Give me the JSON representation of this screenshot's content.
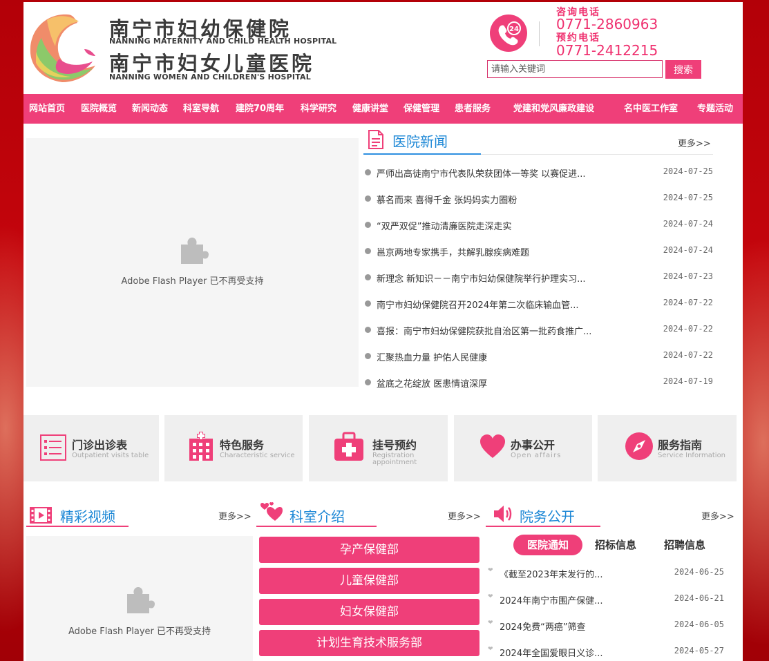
{
  "header": {
    "name_cn_1": "南宁市妇幼保健院",
    "name_en_1": "NANNING MATERNITY AND CHILD HEALTH HOSPITAL",
    "name_cn_2": "南宁市妇女儿童医院",
    "name_en_2": "NANNING WOMEN AND CHILDREN'S HOSPITAL",
    "phone_badge": "24",
    "consult_label": "咨询电话",
    "consult_number": "0771-2860963",
    "appoint_label": "预约电话",
    "appoint_number": "0771-2412215"
  },
  "search": {
    "placeholder": "请输入关键词",
    "button": "搜索"
  },
  "nav": [
    "网站首页",
    "医院概览",
    "新闻动态",
    "科室导航",
    "建院70周年",
    "科学研究",
    "健康讲堂",
    "保健管理",
    "患者服务",
    "党建和党风廉政建设",
    "名中医工作室",
    "专题活动"
  ],
  "flash": {
    "message": "Adobe Flash Player 已不再受支持"
  },
  "news": {
    "title": "医院新闻",
    "more": "更多>>",
    "items": [
      {
        "text": "严师出高徒南宁市代表队荣获团体一等奖 以赛促进...",
        "date": "2024-07-25"
      },
      {
        "text": "慕名而来 喜得千金 张妈妈实力圈粉",
        "date": "2024-07-25"
      },
      {
        "text": "“双严双促”推动清廉医院走深走实",
        "date": "2024-07-24"
      },
      {
        "text": "邕京两地专家携手，共解乳腺疾病难题",
        "date": "2024-07-24"
      },
      {
        "text": "新理念 新知识－－南宁市妇幼保健院举行护理实习...",
        "date": "2024-07-23"
      },
      {
        "text": "南宁市妇幼保健院召开2024年第二次临床输血管...",
        "date": "2024-07-22"
      },
      {
        "text": "喜报：南宁市妇幼保健院获批自治区第一批药食推广...",
        "date": "2024-07-22"
      },
      {
        "text": "汇聚热血力量 护佑人民健康",
        "date": "2024-07-22"
      },
      {
        "text": "盆底之花绽放 医患情谊深厚",
        "date": "2024-07-19"
      }
    ]
  },
  "quick_links": [
    {
      "title": "门诊出诊表",
      "sub": "Outpatient visits table",
      "icon": "schedule-list-icon"
    },
    {
      "title": "特色服务",
      "sub": "Characteristic service",
      "icon": "hospital-building-icon"
    },
    {
      "title": "挂号预约",
      "sub": "Registration appointment",
      "icon": "medical-kit-icon"
    },
    {
      "title": "办事公开",
      "sub": "Open affairs",
      "icon": "heart-icon"
    },
    {
      "title": "服务指南",
      "sub": "Service Information",
      "icon": "compass-icon"
    }
  ],
  "videos": {
    "title": "精彩视频",
    "more": "更多>>"
  },
  "departments": {
    "title": "科室介绍",
    "more": "更多>>",
    "items": [
      "孕产保健部",
      "儿童保健部",
      "妇女保健部",
      "计划生育技术服务部"
    ]
  },
  "affairs": {
    "title": "院务公开",
    "more": "更多>>",
    "tabs": [
      "医院通知",
      "招标信息",
      "招聘信息"
    ],
    "items": [
      {
        "text": "《截至2023年末发行的...",
        "date": "2024-06-25"
      },
      {
        "text": "2024年南宁市围产保健...",
        "date": "2024-06-21"
      },
      {
        "text": "2024免费“两癌”筛查",
        "date": "2024-06-05"
      },
      {
        "text": "2024年全国爱眼日义诊...",
        "date": "2024-05-27"
      }
    ]
  },
  "colors": {
    "brand_pink": "#ef3f79",
    "link_blue": "#1e88d6",
    "page_red": "#b30008"
  }
}
